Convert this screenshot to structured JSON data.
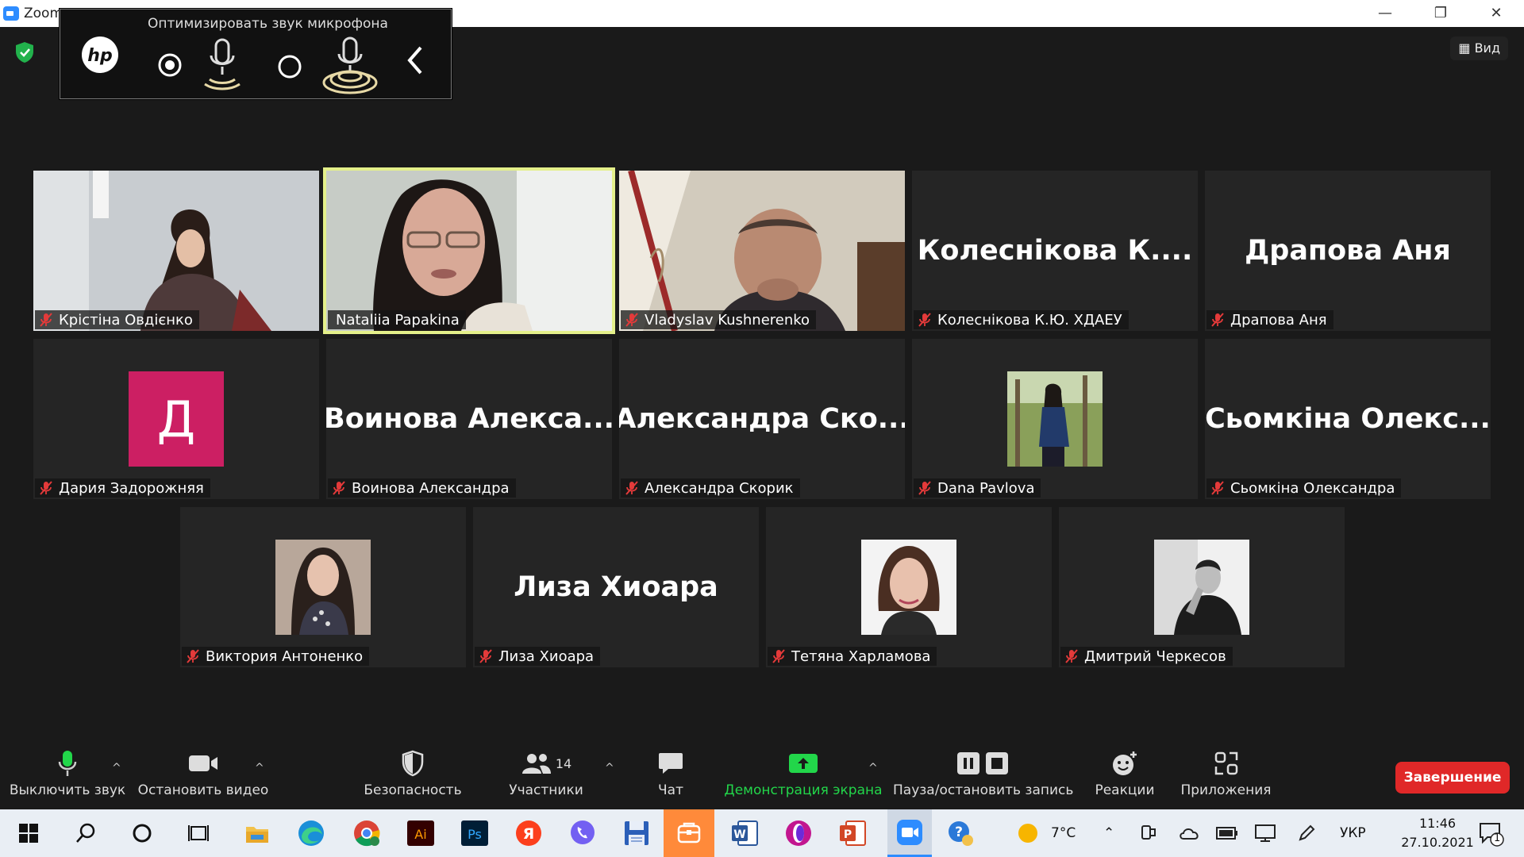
{
  "window": {
    "title": "Zoom"
  },
  "hp_panel": {
    "title": "Оптимизировать звук микрофона"
  },
  "view_button": {
    "label": "Вид"
  },
  "participants": [
    {
      "name": "Крістіна Овдієнко",
      "type": "video",
      "muted": true
    },
    {
      "name": "Nataliia Papakina",
      "type": "video",
      "muted": false,
      "active_speaker": true
    },
    {
      "name": "Vladyslav Kushnerenko",
      "type": "video",
      "muted": true
    },
    {
      "name": "Колеснікова К.Ю. ХДАЕУ",
      "display": "Колеснікова К....",
      "type": "name",
      "muted": true
    },
    {
      "name": "Драпова Аня",
      "display": "Драпова Аня",
      "type": "name",
      "muted": true
    },
    {
      "name": "Дария Задорожняя",
      "display": "Д",
      "type": "letter",
      "muted": true,
      "color": "#cc1f63"
    },
    {
      "name": "Воинова Александра",
      "display": "Воинова  Алекса...",
      "type": "name",
      "muted": true
    },
    {
      "name": "Александра Скорик",
      "display": "Александра  Ско...",
      "type": "name",
      "muted": true
    },
    {
      "name": "Dana Pavlova",
      "type": "avatar",
      "muted": true
    },
    {
      "name": "Сьомкіна Олександра",
      "display": "Сьомкіна  Олекс...",
      "type": "name",
      "muted": true
    },
    {
      "name": "Виктория Антоненко",
      "type": "avatar",
      "muted": true
    },
    {
      "name": "Лиза Хиоара",
      "display": "Лиза Хиоара",
      "type": "name",
      "muted": true
    },
    {
      "name": "Тетяна Харламова",
      "type": "avatar",
      "muted": true
    },
    {
      "name": "Дмитрий Черкесов",
      "type": "avatar",
      "muted": true
    }
  ],
  "toolbar": {
    "mute": "Выключить звук",
    "video": "Остановить видео",
    "security": "Безопасность",
    "participants": "Участники",
    "participants_count": "14",
    "chat": "Чат",
    "share": "Демонстрация экрана",
    "record": "Пауза/остановить запись",
    "reactions": "Реакции",
    "apps": "Приложения",
    "end": "Завершение"
  },
  "taskbar": {
    "weather": "7°C",
    "language": "УКР",
    "time": "11:46",
    "date": "27.10.2021",
    "notifications": "1"
  },
  "colors": {
    "accent_green": "#22d64a",
    "end_red": "#e02828",
    "active_border": "#e4f08a"
  }
}
